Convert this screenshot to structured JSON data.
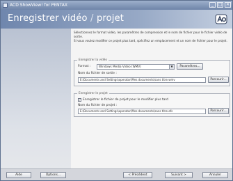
{
  "window": {
    "title": "ACD ShowView! for PENTAX",
    "minimize_glyph": "_",
    "maximize_glyph": "□",
    "close_glyph": "✕"
  },
  "header": {
    "title_part1": "Enregistrer vidéo",
    "separator": " / ",
    "title_part2": "projet",
    "logo_icon": "acd-logo-icon"
  },
  "intro": {
    "line1": "Sélectionnez le format vidéo, les paramètres de compression et le nom de fichier pour le fichier vidéo de sortie.",
    "line2": "Si vous voulez modifier ce projet plus tard, spécifiez un emplacement et un nom de fichier pour le projet."
  },
  "video_group": {
    "title": "Enregistrer la vidéo",
    "format_label": "Format :",
    "format_value": "Windows Media Video (WMV)",
    "params_button": "Paramètres...",
    "output_label": "Nom du fichier de sortie :",
    "output_value": "E:\\Documents and Settings\\operator\\Mes documents\\sans titre.wmv",
    "browse_button": "Parcourir..."
  },
  "project_group": {
    "title": "Enregistrer le projet",
    "save_checkbox_label": "Enregistrer le fichier de projet pour le modifier plus tard",
    "save_checked": true,
    "project_label": "Nom du fichier de projet :",
    "project_value": "E:\\Documents and Settings\\operator\\Mes documents\\sans titre.afs",
    "browse_button": "Parcourir..."
  },
  "footer": {
    "help_button": "Aide",
    "options_button": "Options...",
    "prev_button": "< Précédent",
    "next_button": "Suivant >",
    "cancel_button": "Annuler"
  }
}
